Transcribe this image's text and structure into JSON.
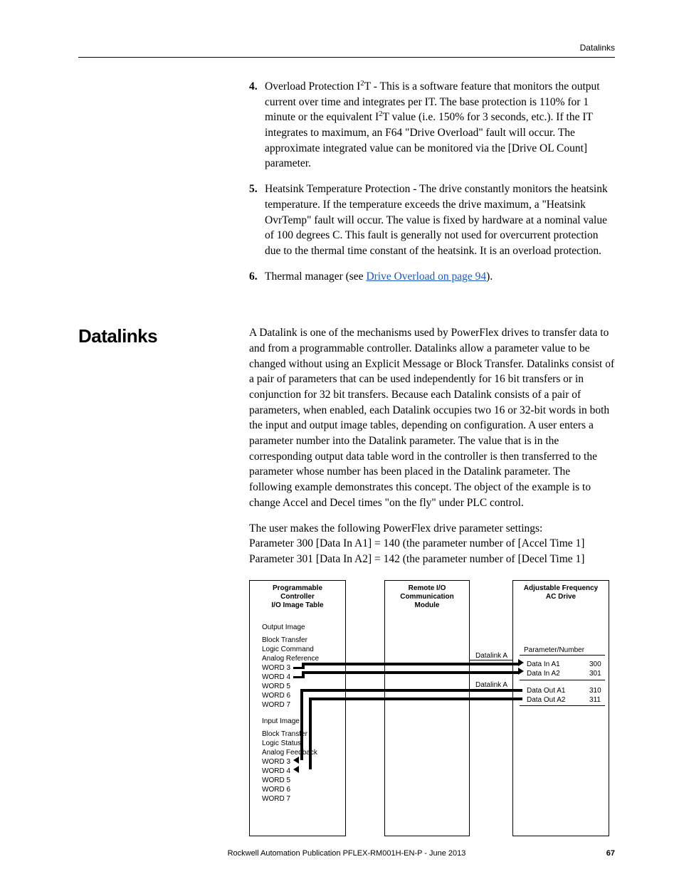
{
  "header": {
    "title": "Datalinks"
  },
  "items": {
    "n4": "4.",
    "t4": "Overload Protection I²T - This is a software feature that monitors the output current over time and integrates per IT. The base protection is 110% for 1 minute or the equivalent I²T value (i.e. 150% for 3 seconds, etc.). If the IT integrates to maximum, an F64 \"Drive Overload\" fault will occur. The approximate integrated value can be monitored via the [Drive OL Count] parameter.",
    "n5": "5.",
    "t5": "Heatsink Temperature Protection - The drive constantly monitors the heatsink temperature. If the temperature exceeds the drive maximum, a \"Heatsink OvrTemp\" fault will occur. The value is fixed by hardware at a nominal value of 100 degrees C. This fault is generally not used for overcurrent protection due to the thermal time constant of the heatsink. It is an overload protection.",
    "n6": "6.",
    "t6a": "Thermal manager (see ",
    "t6link": "Drive Overload on page 94",
    "t6b": ")."
  },
  "section": {
    "title": "Datalinks"
  },
  "body": {
    "p1": "A Datalink is one of the mechanisms used by PowerFlex drives to transfer data to and from a programmable controller. Datalinks allow a parameter value to be changed without using an Explicit Message or Block Transfer. Datalinks consist of a pair of parameters that can be used independently for 16 bit transfers or in conjunction for 32 bit transfers. Because each Datalink consists of a pair of parameters, when enabled, each Datalink occupies two 16 or 32-bit words in both the input and output image tables, depending on configuration. A user enters a parameter number into the Datalink parameter. The value that is in the corresponding output data table word in the controller is then transferred to the parameter whose number has been placed in the Datalink parameter. The following example demonstrates this concept. The object of the example is to change Accel and Decel times \"on the fly\" under PLC control.",
    "p2a": "The user makes the following PowerFlex drive parameter settings:",
    "p2b": "Parameter 300 [Data In A1] = 140 (the parameter number of [Accel Time 1]",
    "p2c": "Parameter 301 [Data In A2] = 142 (the parameter number of [Decel Time 1]"
  },
  "diagram": {
    "box1a": "Programmable",
    "box1b": "Controller",
    "box1c": "I/O Image Table",
    "box2a": "Remote I/O",
    "box2b": "Communication",
    "box2c": "Module",
    "box3a": "Adjustable Frequency",
    "box3b": "AC Drive",
    "out_image": "Output Image",
    "blk_xfer": "Block Transfer",
    "logic_cmd": "Logic Command",
    "analog_ref": "Analog Reference",
    "w3": "WORD 3",
    "w4": "WORD 4",
    "w5": "WORD 5",
    "w6": "WORD 6",
    "w7": "WORD 7",
    "in_image": "Input Image",
    "logic_status": "Logic Status",
    "analog_fb": "Analog Feedback",
    "datalinkA": "Datalink A",
    "param_num": "Parameter/Number",
    "d_in_a1": "Data In A1",
    "d_in_a2": "Data In A2",
    "d_out_a1": "Data Out A1",
    "d_out_a2": "Data Out A2",
    "v300": "300",
    "v301": "301",
    "v310": "310",
    "v311": "311"
  },
  "footer": {
    "pub": "Rockwell Automation Publication PFLEX-RM001H-EN-P - June 2013",
    "page": "67"
  }
}
